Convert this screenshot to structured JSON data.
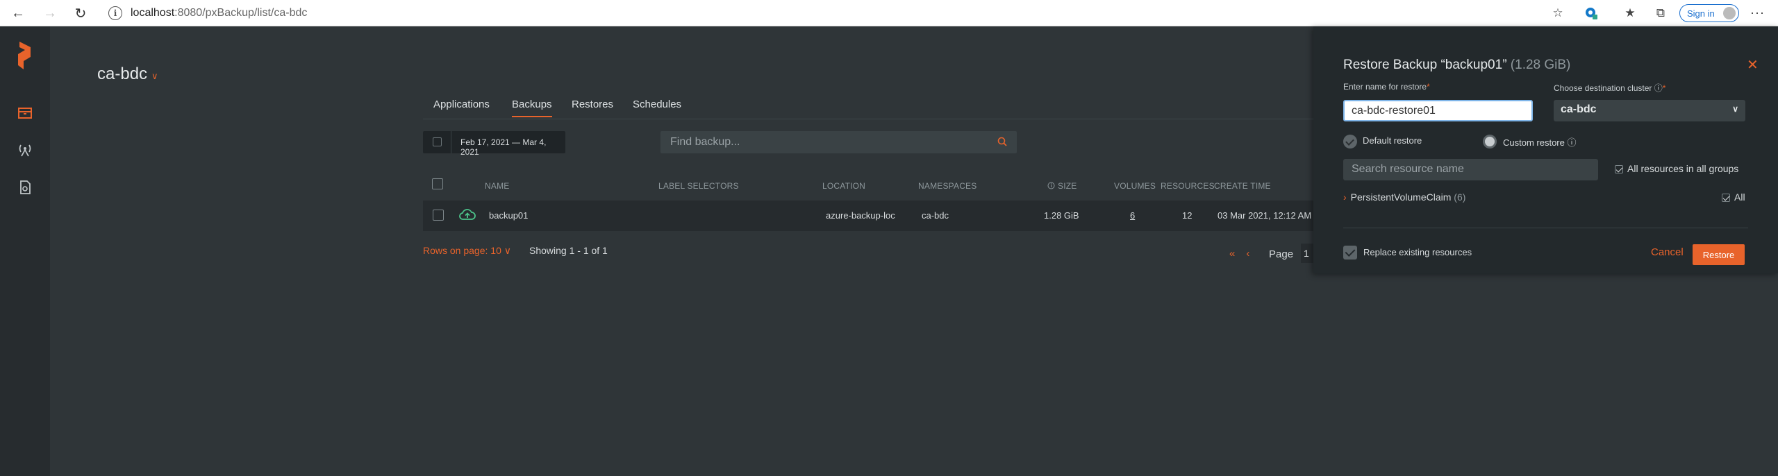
{
  "browser": {
    "url_host": "localhost",
    "url_path": ":8080/pxBackup/list/ca-bdc",
    "sign_in_label": "Sign in"
  },
  "page": {
    "title": "ca-bdc"
  },
  "tabs": [
    "Applications",
    "Backups",
    "Restores",
    "Schedules"
  ],
  "filters": {
    "date_range": "Feb 17, 2021 — Mar 4, 2021",
    "search_placeholder": "Find backup..."
  },
  "table": {
    "columns": {
      "name": "NAME",
      "label_selectors": "LABEL SELECTORS",
      "location": "LOCATION",
      "namespaces": "NAMESPACES",
      "size": "SIZE",
      "volumes": "VOLUMES",
      "resources": "RESOURCES",
      "create_time": "CREATE TIME"
    },
    "rows": [
      {
        "name": "backup01",
        "label_selectors": "",
        "location": "azure-backup-loc",
        "namespaces": "ca-bdc",
        "size": "1.28 GiB",
        "volumes": "6",
        "resources": "12",
        "create_time": "03 Mar 2021, 12:12 AM"
      }
    ]
  },
  "pagination": {
    "rows_per_page": "Rows on page: 10",
    "showing": "Showing 1 - 1 of 1",
    "page_label": "Page",
    "page_number": "1"
  },
  "restore_panel": {
    "title": "Restore Backup “backup01”",
    "size": "(1.28 GiB)",
    "name_label": "Enter name for restore",
    "name_value": "ca-bdc-restore01",
    "cluster_label": "Choose destination cluster",
    "cluster_value": "ca-bdc",
    "default_restore_label": "Default restore",
    "custom_restore_label": "Custom restore",
    "search_placeholder": "Search resource name",
    "all_groups_label": "All resources in all groups",
    "group_name": "PersistentVolumeClaim",
    "group_count": "(6)",
    "group_all_label": "All",
    "replace_label": "Replace existing resources",
    "cancel_label": "Cancel",
    "restore_label": "Restore"
  },
  "colors": {
    "accent": "#e8632b",
    "background": "#2f3538",
    "panel": "#23292c"
  }
}
